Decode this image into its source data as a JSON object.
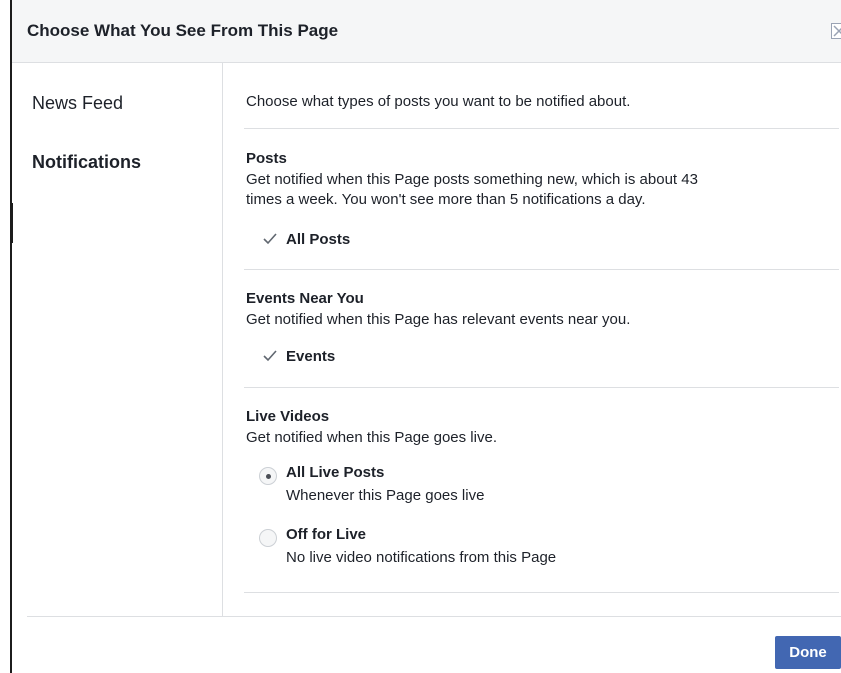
{
  "dialog": {
    "title": "Choose What You See From This Page",
    "close_icon": "close-icon"
  },
  "sidebar": {
    "items": [
      {
        "label": "News Feed",
        "active": false
      },
      {
        "label": "Notifications",
        "active": true
      }
    ]
  },
  "content": {
    "intro": "Choose what types of posts you want to be notified about.",
    "sections": [
      {
        "title": "Posts",
        "description_line1": "Get notified when this Page posts something new, which is about 43",
        "description_line2": "times a week. You won't see more than 5 notifications a day.",
        "option": {
          "label": "All Posts",
          "checked": true
        }
      },
      {
        "title": "Events Near You",
        "description": "Get notified when this Page has relevant events near you.",
        "option": {
          "label": "Events",
          "checked": true
        }
      },
      {
        "title": "Live Videos",
        "description": "Get notified when this Page goes live.",
        "radios": [
          {
            "label": "All Live Posts",
            "description": "Whenever this Page goes live",
            "selected": true
          },
          {
            "label": "Off for Live",
            "description": "No live video notifications from this Page",
            "selected": false
          }
        ]
      }
    ]
  },
  "footer": {
    "done_label": "Done"
  },
  "colors": {
    "accent": "#4267b2",
    "header_bg": "#f5f6f7",
    "divider": "#dddfe2"
  }
}
